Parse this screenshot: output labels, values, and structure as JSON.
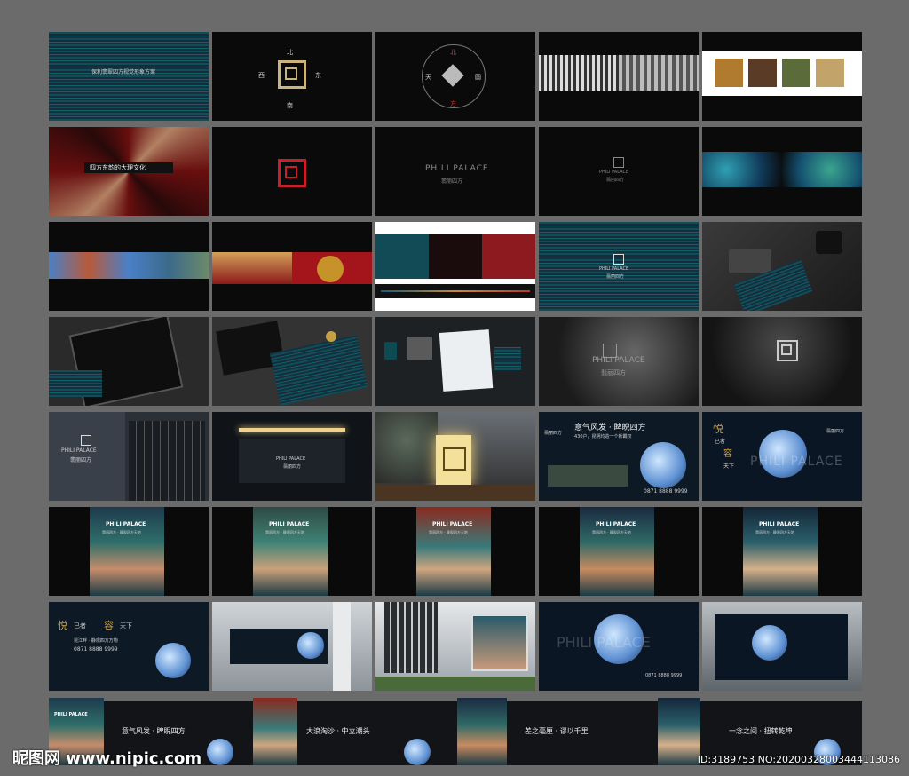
{
  "tiles": {
    "t1": {
      "title": "保利翡翠四方视觉形象方案"
    },
    "t2": {
      "north": "北",
      "west": "西",
      "east": "东",
      "south": "南"
    },
    "t3": {
      "north": "北",
      "west": "天",
      "east": "圆",
      "south": "方"
    },
    "t6": {
      "title": "四方东韵的大理文化"
    },
    "t8": {
      "brand_en": "PHILI PALACE",
      "brand_cn": "翡丽四方"
    },
    "t9": {
      "brand_en": "PHILI PALACE",
      "brand_cn": "翡丽四方"
    },
    "t14": {
      "brand_en": "PHILI PALACE",
      "brand_cn": "翡丽四方"
    },
    "t19": {
      "brand_en": "PHILI PALACE",
      "brand_cn": "翡丽四方"
    },
    "t21": {
      "brand_en": "PHILI PALACE",
      "brand_cn": "翡丽四方"
    },
    "t22": {
      "brand_en": "PHILI PALACE",
      "brand_cn": "翡丽四方"
    },
    "t24": {
      "slogan": "意气风发 · 睥睨四方",
      "sub": "430户，昆明均造一个新霸权",
      "phone": "0871 8888 9999",
      "brand": "翡丽四方"
    },
    "t25": {
      "char1": "悦",
      "char2": "已者",
      "char3": "容",
      "char4": "天下",
      "watermark": "PHILI PALACE",
      "brand": "翡丽四方"
    },
    "posters": {
      "title": "PHILI PALACE",
      "sub": "翡丽四方 · 静观四方天地"
    },
    "t31": {
      "char1": "悦",
      "text1": "已者",
      "char2": "容",
      "text2": "天下",
      "sub": "昆江畔 · 静观四方万物",
      "phone": "0871 8888 9999"
    },
    "t34": {
      "watermark": "PHILI PALACE",
      "phone": "0871 8888 9999"
    },
    "bottom": {
      "b1": "意气风发 · 睥睨四方",
      "b2": "大浪淘沙 · 中立潮头",
      "b3": "差之毫厘 · 谬以千里",
      "b4": "一念之间 · 扭转乾坤",
      "poster_title": "PHILI PALACE"
    }
  },
  "footer": {
    "left": "昵图网 www.nipic.com",
    "right": "ID:3189753 NO:20200328003444113086"
  }
}
